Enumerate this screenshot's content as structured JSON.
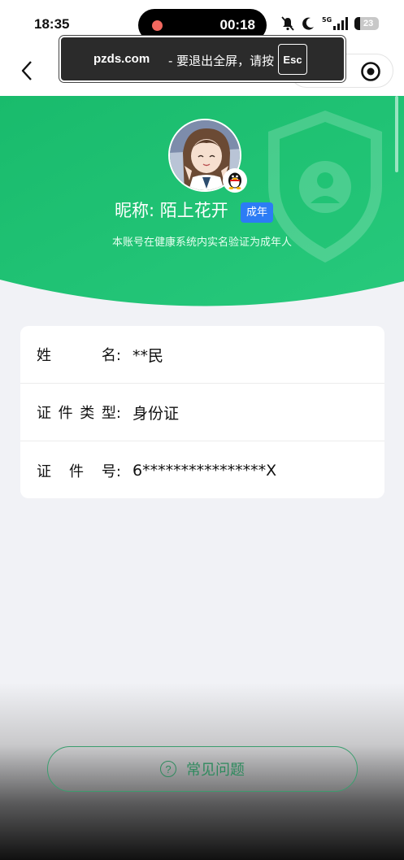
{
  "status_bar": {
    "time": "18:35",
    "recording_timer": "00:18",
    "network": "5G",
    "battery": "23"
  },
  "fullscreen_toast": {
    "domain": "pzds.com",
    "message": "- 要退出全屏，请按",
    "key": "Esc"
  },
  "profile": {
    "nickname": "昵称: 陌上花开",
    "tag": "成年",
    "subtitle": "本账号在健康系统内实名验证为成年人"
  },
  "info": {
    "name_label": [
      "姓",
      "名:"
    ],
    "name_value": "**民",
    "id_type_label": [
      "证",
      "件",
      "类",
      "型:"
    ],
    "id_type_value": "身份证",
    "id_number_label": [
      "证",
      "件",
      "号:"
    ],
    "id_number_value": "6****************X"
  },
  "faq": {
    "label": "常见问题"
  },
  "colors": {
    "header_green": "#1fc372",
    "tag_blue": "#2c7cf5",
    "faq_green": "#2f8a5e"
  }
}
